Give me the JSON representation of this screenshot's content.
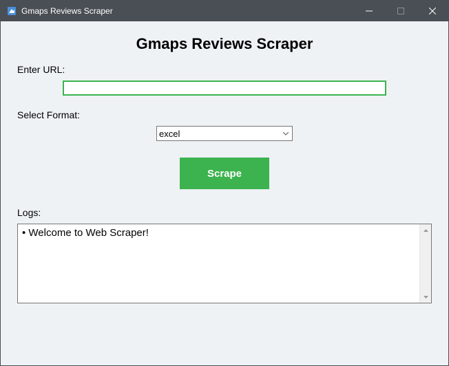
{
  "window": {
    "title": "Gmaps Reviews Scraper"
  },
  "heading": "Gmaps Reviews Scraper",
  "urlSection": {
    "label": "Enter URL:",
    "value": ""
  },
  "formatSection": {
    "label": "Select Format:",
    "selected": "excel"
  },
  "scrapeButton": {
    "label": "Scrape"
  },
  "logsSection": {
    "label": "Logs:",
    "content": "• Welcome to Web Scraper!"
  },
  "colors": {
    "accent": "#3cb34f",
    "titlebar": "#4a4f55",
    "clientBg": "#eef2f5"
  }
}
